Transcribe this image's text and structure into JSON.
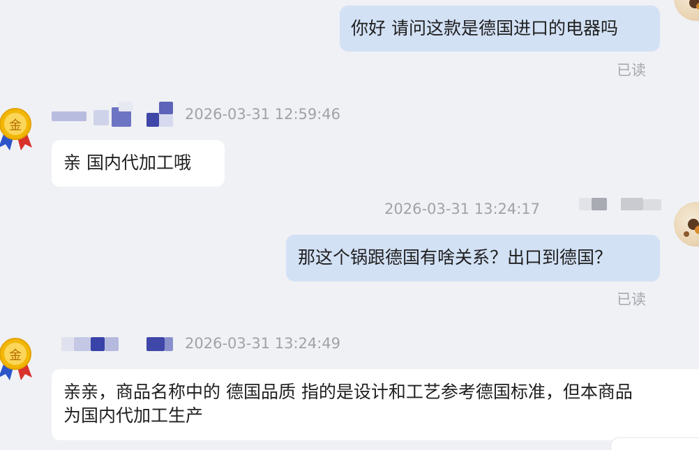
{
  "messages": [
    {
      "id": "m1",
      "text": "你好 请问这款是德国进口的电器吗",
      "read_status": "已读"
    },
    {
      "id": "m2",
      "timestamp": "2026-03-31 12:59:46",
      "text": "亲  国内代加工哦"
    },
    {
      "id": "m3",
      "timestamp": "2026-03-31 13:24:17",
      "text": "那这个锅跟德国有啥关系？出口到德国？",
      "read_status": "已读"
    },
    {
      "id": "m4",
      "timestamp": "2026-03-31 13:24:49",
      "lines": [
        "亲亲，商品名称中的 德国品质 指的是设计和工艺参考德国标准，但本商品",
        "为国内代加工生产"
      ]
    }
  ],
  "badge": {
    "char": "金",
    "gold": "#f2b705",
    "ribbon_red": "#d8322a",
    "ribbon_blue": "#2b55c9"
  },
  "colors": {
    "background": "#f0f1f5",
    "outgoing_bubble": "#d3e1f5",
    "incoming_bubble": "#ffffff"
  }
}
